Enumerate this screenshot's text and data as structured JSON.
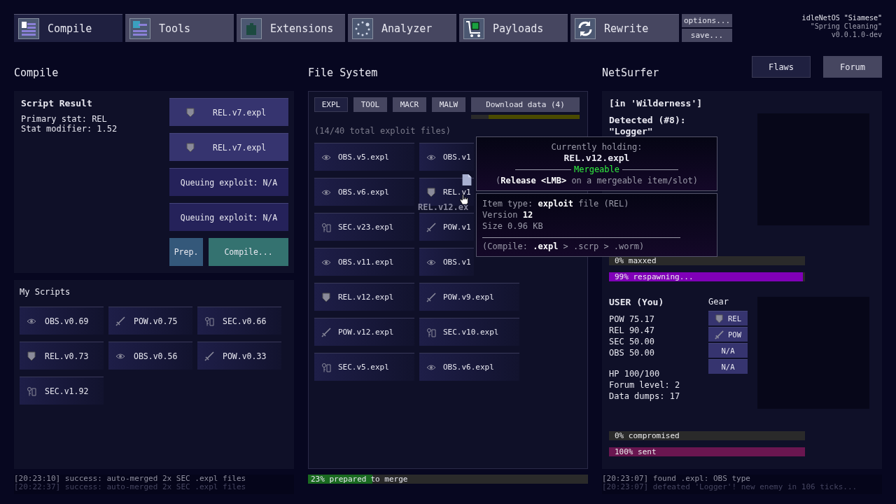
{
  "nav_tabs": [
    {
      "label": "Compile",
      "selected": true
    },
    {
      "label": "Tools",
      "selected": false
    },
    {
      "label": "Extensions",
      "selected": false
    },
    {
      "label": "Analyzer",
      "selected": false
    },
    {
      "label": "Payloads",
      "selected": false
    },
    {
      "label": "Rewrite",
      "selected": false
    }
  ],
  "menu_buttons": [
    "options...",
    "save..."
  ],
  "version": {
    "name": "idleNetOS \"Siamese\"",
    "codename": "\"Spring Cleaning\"",
    "build": "v0.0.1.0-dev"
  },
  "compile": {
    "title": "Compile",
    "script_result": {
      "title": "Script Result",
      "lines": [
        "Primary stat: REL",
        "Stat modifier: 1.52"
      ]
    },
    "slots": [
      {
        "kind": "file",
        "label": "REL.v7.expl"
      },
      {
        "kind": "file",
        "label": "REL.v7.expl"
      },
      {
        "kind": "empty",
        "label": "Queuing exploit: N/A"
      },
      {
        "kind": "empty",
        "label": "Queuing exploit: N/A"
      }
    ],
    "prep_button": "Prep.",
    "compile_button": "Compile...",
    "my_scripts": {
      "title": "My Scripts",
      "items": [
        {
          "kind": "obs",
          "label": "OBS.v0.69"
        },
        {
          "kind": "pow",
          "label": "POW.v0.75"
        },
        {
          "kind": "sec",
          "label": "SEC.v0.66"
        },
        {
          "kind": "rel",
          "label": "REL.v0.73"
        },
        {
          "kind": "obs",
          "label": "OBS.v0.56"
        },
        {
          "kind": "pow",
          "label": "POW.v0.33"
        },
        {
          "kind": "sec",
          "label": "SEC.v1.92"
        }
      ]
    },
    "log": [
      "[20:23:10] success: auto-merged 2x SEC .expl files",
      "[20:22:37] success: auto-merged 2x SEC .expl files"
    ]
  },
  "file_system": {
    "title": "File System",
    "filters": [
      {
        "label": "EXPL",
        "selected": true
      },
      {
        "label": "TOOL",
        "selected": false
      },
      {
        "label": "MACR",
        "selected": false
      },
      {
        "label": "MALW",
        "selected": false
      }
    ],
    "download": {
      "label": "Download data (4)",
      "level": 0.84
    },
    "count": "(14/40 total exploit files)",
    "files": [
      {
        "kind": "obs",
        "label": "OBS.v5.expl"
      },
      {
        "kind": "obs",
        "label": "OBS.v1"
      },
      {
        "kind": "obs",
        "label": "OBS.v6.expl"
      },
      {
        "kind": "rel",
        "label": "REL.v1"
      },
      {
        "kind": "sec",
        "label": "SEC.v23.expl"
      },
      {
        "kind": "pow",
        "label": "POW.v1"
      },
      {
        "kind": "obs",
        "label": "OBS.v11.expl"
      },
      {
        "kind": "obs",
        "label": "OBS.v1"
      },
      {
        "kind": "rel",
        "label": "REL.v12.expl"
      },
      {
        "kind": "pow",
        "label": "POW.v9.expl"
      },
      {
        "kind": "pow",
        "label": "POW.v12.expl"
      },
      {
        "kind": "sec",
        "label": "SEC.v10.expl"
      },
      {
        "kind": "sec",
        "label": "SEC.v5.expl"
      },
      {
        "kind": "obs",
        "label": "OBS.v6.expl"
      }
    ],
    "dragged_label": "REL.v12.ex",
    "merge": {
      "level": 0.23,
      "label": "23% prepared",
      "suffix": "to merge"
    }
  },
  "tooltip": {
    "heading": "Currently holding:",
    "item": "REL.v12.expl",
    "status": "Mergeable",
    "hint": "(**Release** **<LMB>** on a mergeable item/slot)",
    "details": [
      "Item type: **exploit** file (REL)",
      "Version **12**",
      "Size 0.96 KB"
    ],
    "footer": "(Compile: **.expl** > .scrp > .worm)"
  },
  "netsurfer": {
    "title": "NetSurfer",
    "tabs": [
      {
        "label": "Flaws",
        "selected": true
      },
      {
        "label": "Forum",
        "selected": false
      }
    ],
    "location": "[in 'Wilderness']",
    "detected": "Detected (#8):",
    "enemy": "\"Logger\"",
    "enemy_bars": [
      {
        "label": "0% maxxed",
        "level": 0,
        "kind": "grey"
      },
      {
        "label": "99% respawning...",
        "level": 0.99,
        "kind": "purple"
      }
    ],
    "user": {
      "title": "USER (You)",
      "stats": [
        "POW 75.17",
        "REL 90.47",
        "SEC 50.00",
        "OBS 50.00"
      ],
      "info": [
        "HP 100/100",
        "Forum level: 2",
        "Data dumps: 17"
      ]
    },
    "gear": {
      "title": "Gear",
      "slots": [
        {
          "kind": "rel",
          "label": "REL"
        },
        {
          "kind": "pow",
          "label": "POW"
        },
        {
          "kind": "none",
          "label": "N/A"
        },
        {
          "kind": "none",
          "label": "N/A"
        }
      ]
    },
    "user_bars": [
      {
        "label": "0% compromised",
        "level": 0,
        "kind": "grey"
      },
      {
        "label": "100% sent",
        "level": 1,
        "kind": "magenta"
      }
    ],
    "log": [
      "[20:23:07] found .expl: OBS type",
      "[20:23:07] defeated 'Logger'! new enemy in 106 ticks..."
    ]
  }
}
